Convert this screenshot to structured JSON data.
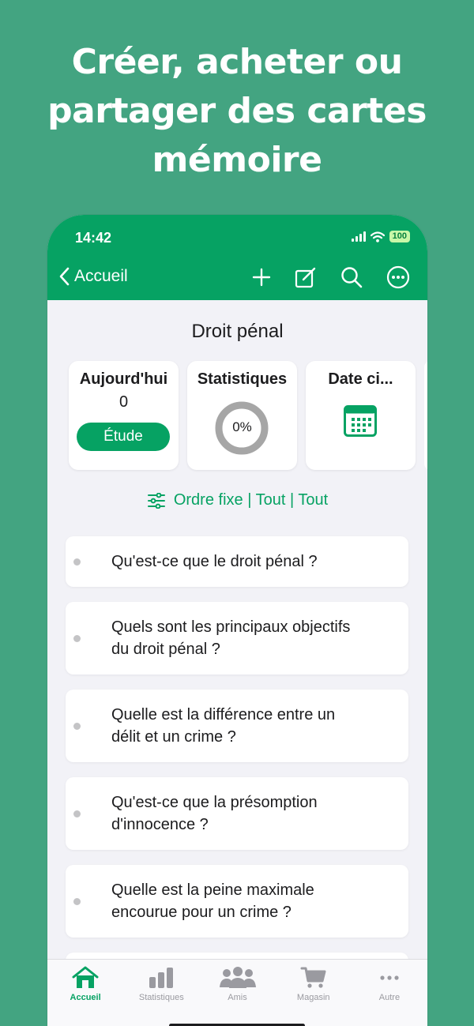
{
  "headline": {
    "line1": "Créer, acheter ou",
    "line2": "partager des cartes",
    "line3": "mémoire"
  },
  "status_bar": {
    "time": "14:42",
    "battery": "100"
  },
  "nav": {
    "back_label": "Accueil",
    "actions": [
      "plus-icon",
      "edit-icon",
      "search-icon",
      "more-icon"
    ]
  },
  "deck": {
    "title": "Droit pénal"
  },
  "cards": {
    "today": {
      "label": "Aujourd'hui",
      "count": "0",
      "button": "Étude"
    },
    "stats": {
      "label": "Statistiques",
      "percent": "0%",
      "progress": 0
    },
    "date": {
      "label": "Date ci..."
    }
  },
  "filter": {
    "label": "Ordre fixe | Tout | Tout"
  },
  "questions": [
    {
      "line1": "Qu'est-ce que le droit pénal ?",
      "line2": ""
    },
    {
      "line1": "Quels sont les principaux objectifs",
      "line2": "du droit pénal ?"
    },
    {
      "line1": "Quelle est la différence entre un",
      "line2": "délit et un crime ?"
    },
    {
      "line1": "Qu'est-ce que la présomption",
      "line2": "d'innocence ?"
    },
    {
      "line1": "Quelle est la peine maximale",
      "line2": "encourue pour un crime ?"
    },
    {
      "line1": "",
      "line2": ""
    }
  ],
  "tabs": [
    {
      "label": "Accueil",
      "icon": "home-icon",
      "active": true
    },
    {
      "label": "Statistiques",
      "icon": "bar-chart-icon",
      "active": false
    },
    {
      "label": "Amis",
      "icon": "people-icon",
      "active": false
    },
    {
      "label": "Magasin",
      "icon": "cart-icon",
      "active": false
    },
    {
      "label": "Autre",
      "icon": "ellipsis-icon",
      "active": false
    }
  ],
  "colors": {
    "background": "#43a481",
    "accent": "#06a263",
    "surface": "#f2f2f7",
    "ring_track": "#a6a6a6"
  }
}
